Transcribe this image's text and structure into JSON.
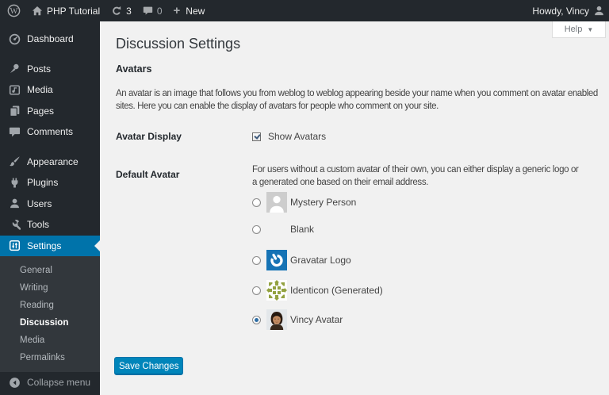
{
  "admin_bar": {
    "site_name": "PHP Tutorial",
    "updates_count": "3",
    "comments_count": "0",
    "new_label": "New",
    "howdy": "Howdy, Vincy"
  },
  "help": {
    "label": "Help"
  },
  "sidebar": {
    "items": [
      {
        "label": "Dashboard"
      },
      {
        "label": "Posts"
      },
      {
        "label": "Media"
      },
      {
        "label": "Pages"
      },
      {
        "label": "Comments"
      },
      {
        "label": "Appearance"
      },
      {
        "label": "Plugins"
      },
      {
        "label": "Users"
      },
      {
        "label": "Tools"
      },
      {
        "label": "Settings",
        "current": true
      }
    ],
    "settings_submenu": [
      {
        "label": "General"
      },
      {
        "label": "Writing"
      },
      {
        "label": "Reading"
      },
      {
        "label": "Discussion",
        "current": true
      },
      {
        "label": "Media"
      },
      {
        "label": "Permalinks"
      }
    ],
    "collapse_label": "Collapse menu"
  },
  "page": {
    "title": "Discussion Settings",
    "section_heading": "Avatars",
    "section_description": "An avatar is an image that follows you from weblog to weblog appearing beside your name when you comment on avatar enabled sites. Here you can enable the display of avatars for people who comment on your site.",
    "avatar_display": {
      "label": "Avatar Display",
      "checkbox_label": "Show Avatars",
      "checked": true
    },
    "default_avatar": {
      "label": "Default Avatar",
      "description": "For users without a custom avatar of their own, you can either display a generic logo or a generated one based on their email address.",
      "options": [
        {
          "label": "Mystery Person",
          "avatar": "mystery",
          "selected": false
        },
        {
          "label": "Blank",
          "avatar": "blank",
          "selected": false
        },
        {
          "label": "Gravatar Logo",
          "avatar": "gravatar",
          "selected": false
        },
        {
          "label": "Identicon (Generated)",
          "avatar": "identicon",
          "selected": false
        },
        {
          "label": "Vincy Avatar",
          "avatar": "photo",
          "selected": true
        }
      ]
    },
    "save_button": "Save Changes"
  },
  "colors": {
    "admin_bar_bg": "#23282d",
    "sidebar_bg": "#23282d",
    "submenu_bg": "#32373c",
    "current_menu_bg": "#0073aa",
    "content_bg": "#f1f1f1",
    "button_bg": "#0085ba",
    "gravatar_blue": "#1673b5",
    "identicon_olive": "#94a347"
  }
}
